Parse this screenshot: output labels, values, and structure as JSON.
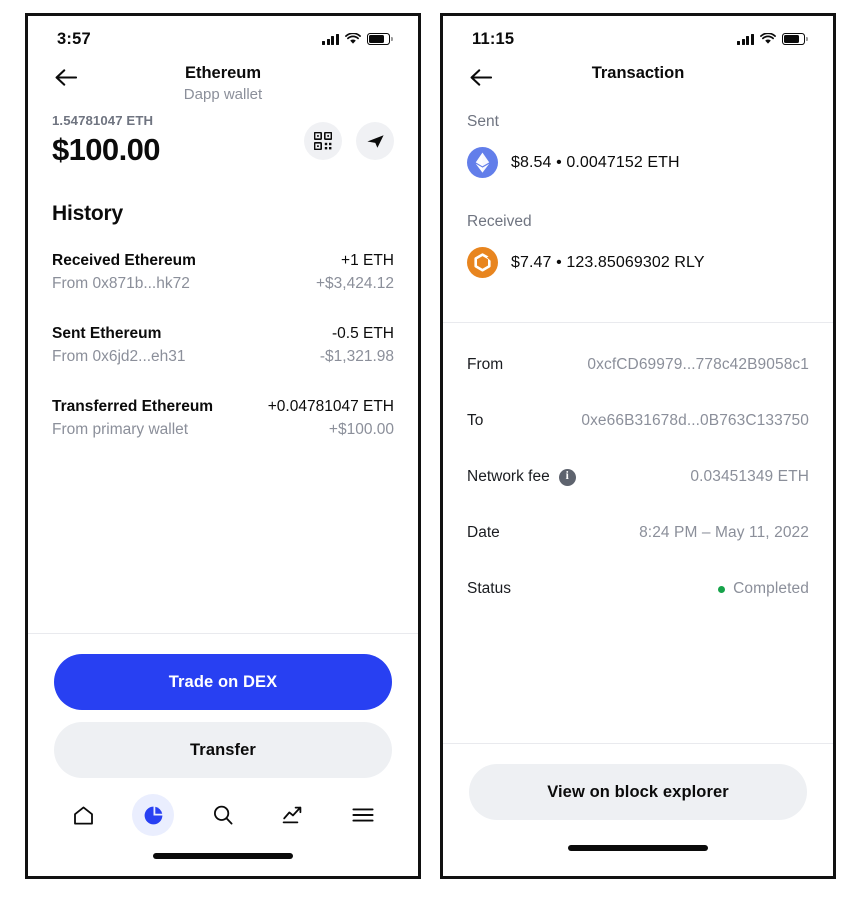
{
  "theme": {
    "accent_blue": "#2840F2",
    "accent_blue_soft": "#EAEEFE",
    "surface_grey": "#EEF0F3",
    "text_primary": "#0B0B0B",
    "text_muted": "#8B8F9A",
    "eth_token_color": "#627EEA",
    "rly_token_color": "#E8851F",
    "status_success": "#16A34A"
  },
  "wallet_screen": {
    "status_bar": {
      "time": "3:57",
      "signal_icon": "signal-bars-icon",
      "wifi_icon": "wifi-icon",
      "battery_icon": "battery-icon"
    },
    "header": {
      "back_icon": "arrow-left-icon",
      "title": "Ethereum",
      "subtitle": "Dapp wallet"
    },
    "balance": {
      "crypto": "1.54781047 ETH",
      "fiat": "$100.00",
      "actions": [
        {
          "name": "qr-code-button",
          "icon": "qr-code-icon"
        },
        {
          "name": "send-button",
          "icon": "paper-plane-icon"
        }
      ]
    },
    "history": {
      "title": "History",
      "transactions": [
        {
          "title": "Received Ethereum",
          "subtitle": "From 0x871b...hk72",
          "amount": "+1 ETH",
          "fiat": "+$3,424.12"
        },
        {
          "title": "Sent Ethereum",
          "subtitle": "From 0x6jd2...eh31",
          "amount": "-0.5 ETH",
          "fiat": "-$1,321.98"
        },
        {
          "title": "Transferred Ethereum",
          "subtitle": "From primary wallet",
          "amount": "+0.04781047 ETH",
          "fiat": "+$100.00"
        }
      ]
    },
    "footer": {
      "primary_button": "Trade on DEX",
      "secondary_button": "Transfer"
    },
    "tabbar": [
      {
        "name": "tab-home",
        "icon": "home-icon",
        "active": false
      },
      {
        "name": "tab-portfolio",
        "icon": "pie-chart-icon",
        "active": true
      },
      {
        "name": "tab-search",
        "icon": "search-icon",
        "active": false
      },
      {
        "name": "tab-markets",
        "icon": "trending-up-icon",
        "active": false
      },
      {
        "name": "tab-menu",
        "icon": "hamburger-menu-icon",
        "active": false
      }
    ]
  },
  "transaction_screen": {
    "status_bar": {
      "time": "11:15",
      "signal_icon": "signal-bars-icon",
      "wifi_icon": "wifi-icon",
      "battery_icon": "battery-icon"
    },
    "header": {
      "back_icon": "arrow-left-icon",
      "title": "Transaction"
    },
    "sent": {
      "label": "Sent",
      "token_icon": "ethereum-token-icon",
      "value": "$8.54 • 0.0047152 ETH"
    },
    "received": {
      "label": "Received",
      "token_icon": "rally-token-icon",
      "value": "$7.47 • 123.85069302 RLY"
    },
    "details": [
      {
        "key": "From",
        "value": "0xcfCD69979...778c42B9058c1",
        "info": false
      },
      {
        "key": "To",
        "value": "0xe66B31678d...0B763C133750",
        "info": false
      },
      {
        "key": "Network fee",
        "value": "0.03451349 ETH",
        "info": true,
        "info_icon": "info-circle-icon"
      },
      {
        "key": "Date",
        "value": "8:24 PM – May 11, 2022",
        "info": false
      },
      {
        "key": "Status",
        "value": "Completed",
        "info": false,
        "status": true
      }
    ],
    "footer": {
      "explorer_button": "View on block explorer"
    }
  }
}
